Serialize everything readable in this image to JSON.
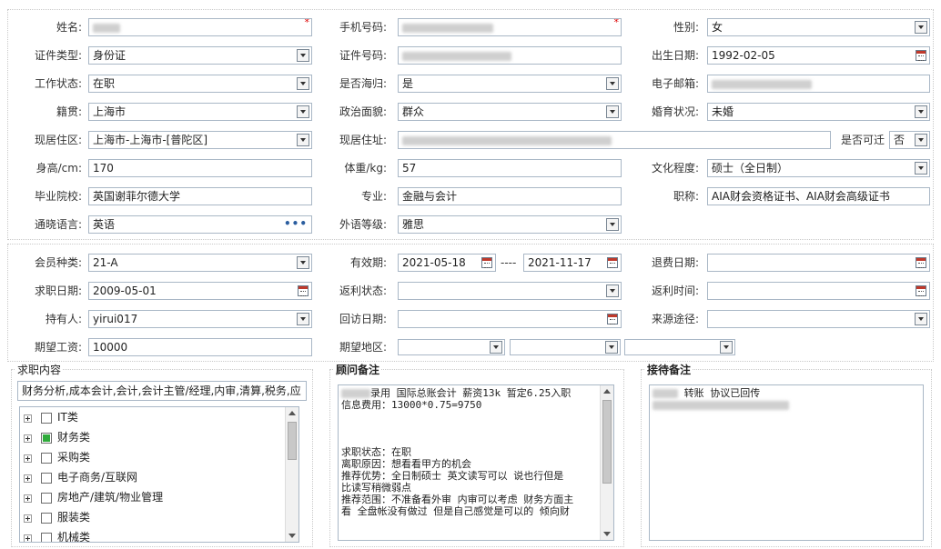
{
  "section1": {
    "name": {
      "label": "姓名:",
      "required": "*"
    },
    "phone": {
      "label": "手机号码:",
      "required": "*"
    },
    "gender": {
      "label": "性别:",
      "value": "女"
    },
    "id_type": {
      "label": "证件类型:",
      "value": "身份证"
    },
    "id_no": {
      "label": "证件号码:"
    },
    "birth": {
      "label": "出生日期:",
      "value": "1992-02-05"
    },
    "work_status": {
      "label": "工作状态:",
      "value": "在职"
    },
    "returnee": {
      "label": "是否海归:",
      "value": "是"
    },
    "email": {
      "label": "电子邮箱:"
    },
    "native": {
      "label": "籍贯:",
      "value": "上海市"
    },
    "political": {
      "label": "政治面貌:",
      "value": "群众"
    },
    "marital": {
      "label": "婚育状况:",
      "value": "未婚"
    },
    "residence": {
      "label": "现居住区:",
      "value": "上海市-上海市-[普陀区]"
    },
    "address": {
      "label": "现居住址:"
    },
    "migrate": {
      "label": "是否可迁",
      "value": "否"
    },
    "height": {
      "label": "身高/cm:",
      "value": "170"
    },
    "weight": {
      "label": "体重/kg:",
      "value": "57"
    },
    "education": {
      "label": "文化程度:",
      "value": "硕士（全日制）"
    },
    "school": {
      "label": "毕业院校:",
      "value": "英国谢菲尔德大学"
    },
    "major": {
      "label": "专业:",
      "value": "金融与会计"
    },
    "title": {
      "label": "职称:",
      "value": "AIA财会资格证书、AIA财会高级证书"
    },
    "language": {
      "label": "通晓语言:",
      "value": "英语",
      "more": "•••"
    },
    "lang_level": {
      "label": "外语等级:",
      "value": "雅思"
    }
  },
  "section2": {
    "member_type": {
      "label": "会员种类:",
      "value": "21-A"
    },
    "valid": {
      "label": "有效期:",
      "from": "2021-05-18",
      "sep": "----",
      "to": "2021-11-17"
    },
    "refund_date": {
      "label": "退费日期:",
      "value": ""
    },
    "job_date": {
      "label": "求职日期:",
      "value": "2009-05-01"
    },
    "rebate_status": {
      "label": "返利状态:",
      "value": ""
    },
    "rebate_time": {
      "label": "返利时间:",
      "value": ""
    },
    "holder": {
      "label": "持有人:",
      "value": "yirui017"
    },
    "visit_date": {
      "label": "回访日期:",
      "value": ""
    },
    "source": {
      "label": "来源途径:",
      "value": ""
    },
    "salary": {
      "label": "期望工资:",
      "value": "10000"
    },
    "area": {
      "label": "期望地区:"
    }
  },
  "job_content": {
    "title": "求职内容",
    "summary": "财务分析,成本会计,会计,会计主管/经理,内审,清算,税务,应",
    "items": [
      {
        "label": "IT类",
        "checked": false
      },
      {
        "label": "财务类",
        "checked": true
      },
      {
        "label": "采购类",
        "checked": false
      },
      {
        "label": "电子商务/互联网",
        "checked": false
      },
      {
        "label": "房地产/建筑/物业管理",
        "checked": false
      },
      {
        "label": "服装类",
        "checked": false
      },
      {
        "label": "机械类",
        "checked": false
      }
    ]
  },
  "advisor_notes": {
    "title": "顾问备注",
    "lines": [
      "录用 国际总账会计 薪资13k 暂定6.25入职",
      "信息费用：13000*0.75=9750",
      "",
      "",
      "",
      "求职状态：在职",
      "离职原因：想看看甲方的机会",
      "推荐优势：全日制硕士  英文读写可以 说也行但是",
      "比读写稍微弱点",
      "推荐范围：不准备看外审 内审可以考虑 财务方面主",
      "看  全盘帐没有做过 但是自己感觉是可以的 倾向财"
    ]
  },
  "reception_notes": {
    "title": "接待备注",
    "line1": "转账  协议已回传"
  }
}
